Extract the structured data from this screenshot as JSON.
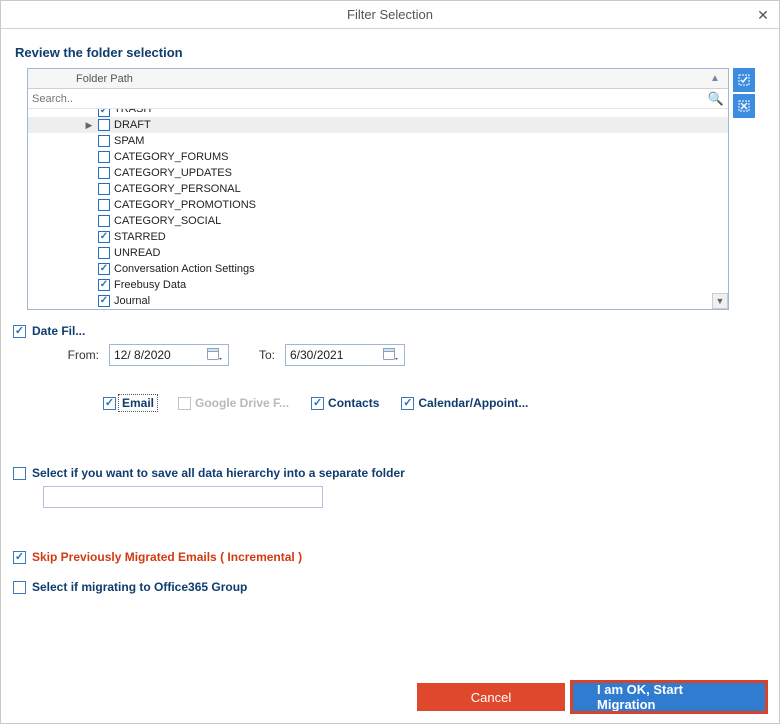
{
  "window": {
    "title": "Filter Selection"
  },
  "header": {
    "review_label": "Review the folder selection"
  },
  "grid": {
    "column_header": "Folder Path",
    "search_placeholder": "Search..",
    "rows": [
      {
        "label": "TRASH",
        "checked": true,
        "selected": false,
        "expandable": false,
        "clipped": true
      },
      {
        "label": "DRAFT",
        "checked": false,
        "selected": true,
        "expandable": true
      },
      {
        "label": "SPAM",
        "checked": false
      },
      {
        "label": "CATEGORY_FORUMS",
        "checked": false
      },
      {
        "label": "CATEGORY_UPDATES",
        "checked": false
      },
      {
        "label": "CATEGORY_PERSONAL",
        "checked": false
      },
      {
        "label": "CATEGORY_PROMOTIONS",
        "checked": false
      },
      {
        "label": "CATEGORY_SOCIAL",
        "checked": false
      },
      {
        "label": "STARRED",
        "checked": true
      },
      {
        "label": "UNREAD",
        "checked": false
      },
      {
        "label": "Conversation Action Settings",
        "checked": true
      },
      {
        "label": "Freebusy Data",
        "checked": true
      },
      {
        "label": "Journal",
        "checked": true
      }
    ]
  },
  "date_filter": {
    "label": "Date Fil...",
    "checked": true,
    "from_label": "From:",
    "from_value": "12/  8/2020",
    "to_label": "To:",
    "to_value": "6/30/2021"
  },
  "type_filters": {
    "email": {
      "label": "Email",
      "checked": true,
      "enabled": true
    },
    "drive": {
      "label": "Google Drive F...",
      "checked": false,
      "enabled": false
    },
    "contacts": {
      "label": "Contacts",
      "checked": true,
      "enabled": true
    },
    "calendar": {
      "label": "Calendar/Appoint...",
      "checked": true,
      "enabled": true
    }
  },
  "hierarchy": {
    "label": "Select if you want to save all data hierarchy into a separate folder",
    "checked": false,
    "value": ""
  },
  "skip": {
    "label": "Skip Previously Migrated Emails ( Incremental )",
    "checked": true
  },
  "o365": {
    "label": "Select if migrating to Office365 Group",
    "checked": false
  },
  "buttons": {
    "cancel": "Cancel",
    "start": "I am OK, Start Migration"
  }
}
